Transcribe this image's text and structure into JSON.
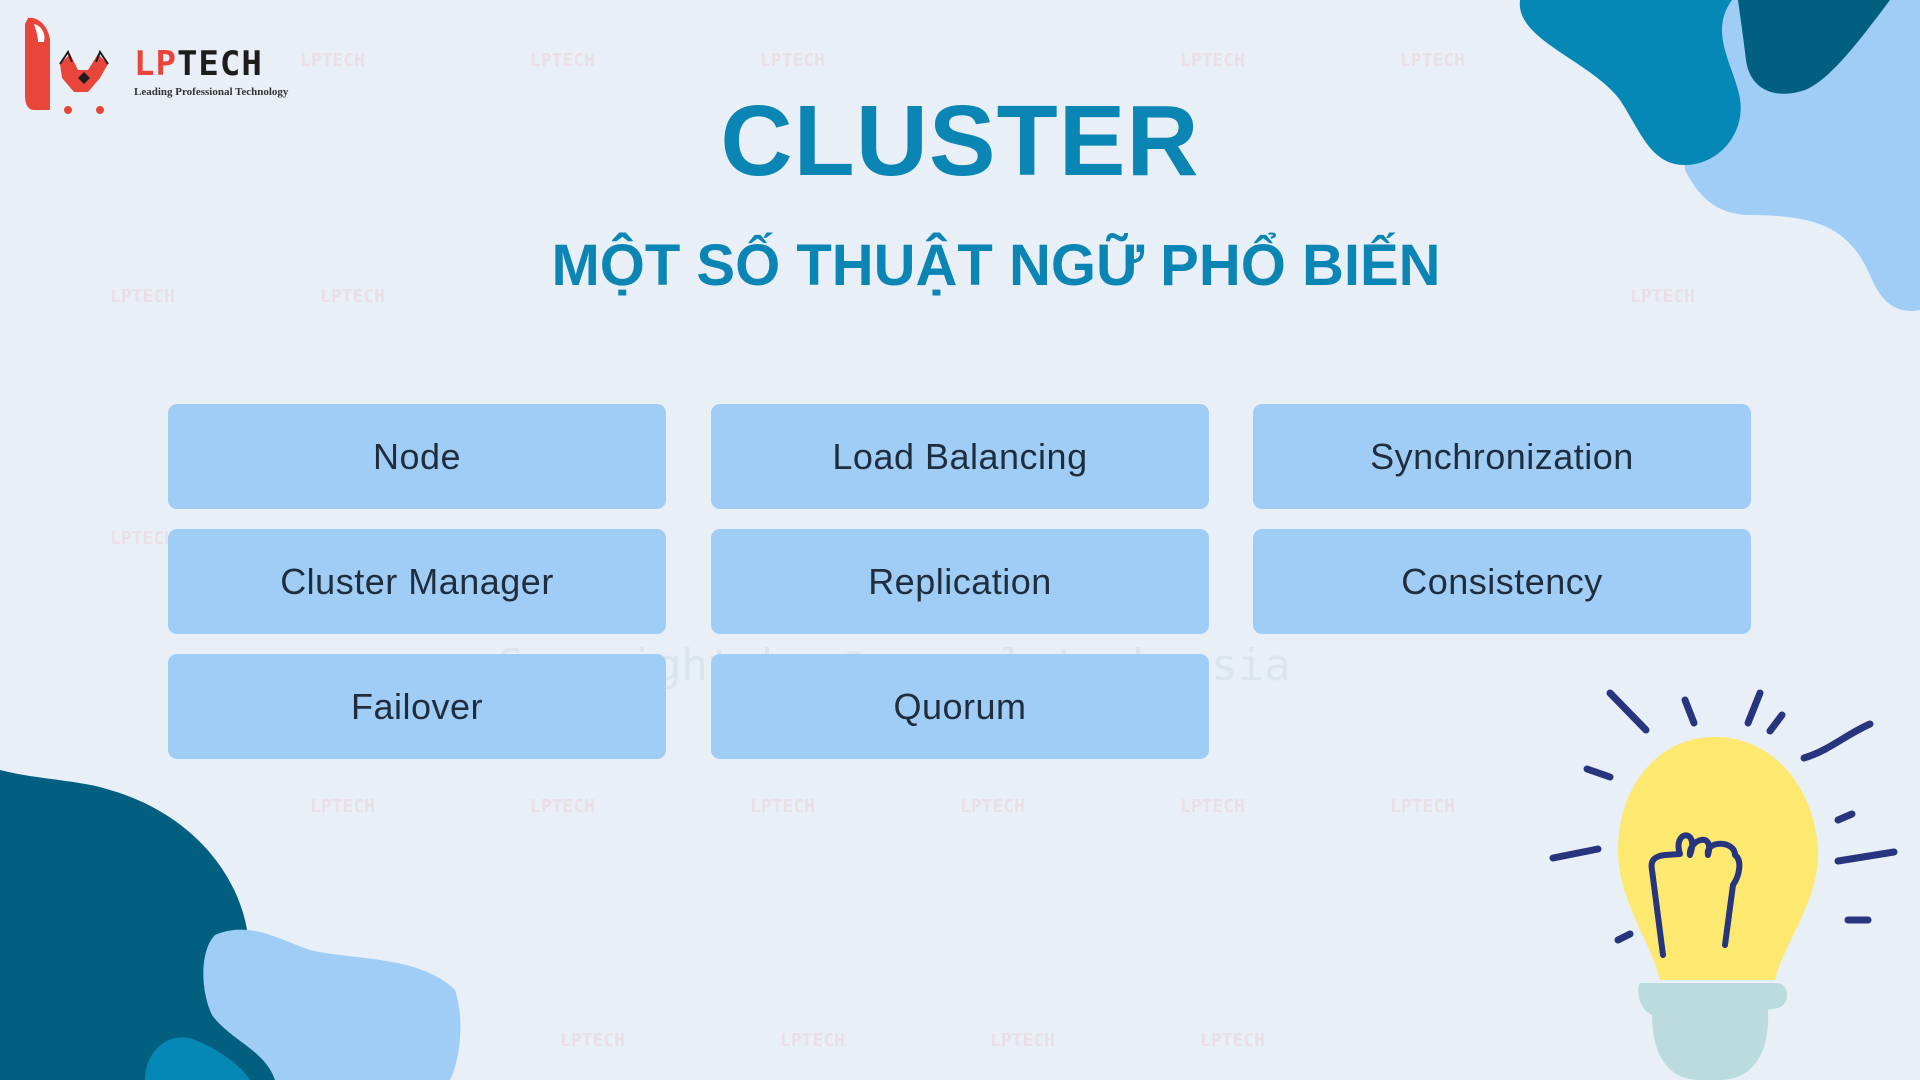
{
  "logo": {
    "word_accent": "LP",
    "word_rest": "TECH",
    "tagline": "Leading Professional Technology"
  },
  "title": "CLUSTER",
  "subtitle": "MỘT SỐ THUẬT NGỮ PHỔ BIẾN",
  "terms": [
    {
      "label": "Node"
    },
    {
      "label": "Load Balancing"
    },
    {
      "label": "Synchronization"
    },
    {
      "label": "Cluster Manager"
    },
    {
      "label": "Replication"
    },
    {
      "label": "Consistency"
    },
    {
      "label": "Failover"
    },
    {
      "label": "Quorum"
    }
  ],
  "watermark": "Copyright by © www.lptech.asia",
  "watermark_logo": "LPTECH",
  "colors": {
    "background": "#e9eff7",
    "accent": "#0b85b4",
    "box": "#a0cdf6",
    "dark_blob": "#035f80",
    "bulb": "#fde870",
    "bulb_base": "#bcdbdf",
    "rays": "#27347e",
    "logo_red": "#e8463a"
  }
}
